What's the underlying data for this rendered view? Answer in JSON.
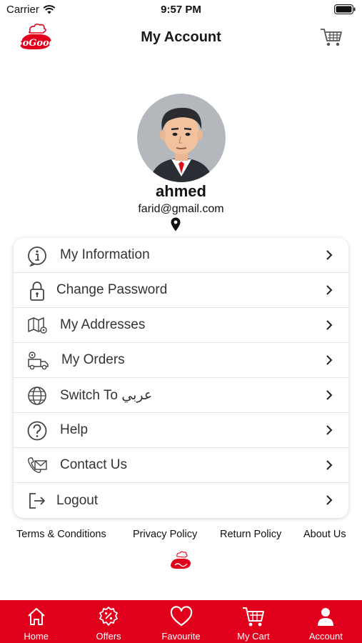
{
  "status_bar": {
    "carrier": "Carrier",
    "time": "9:57 PM"
  },
  "header": {
    "title": "My Account",
    "logo_text": "SoGood"
  },
  "profile": {
    "name": "ahmed",
    "email": "farid@gmail.com"
  },
  "menu": [
    {
      "label": "My Information",
      "icon": "info-icon"
    },
    {
      "label": "Change Password",
      "icon": "lock-icon"
    },
    {
      "label": "My Addresses",
      "icon": "map-icon"
    },
    {
      "label": "My Orders",
      "icon": "delivery-truck-icon"
    },
    {
      "label": "Switch To عربي",
      "icon": "globe-icon"
    },
    {
      "label": "Help",
      "icon": "help-icon"
    },
    {
      "label": "Contact Us",
      "icon": "contact-icon"
    },
    {
      "label": "Logout",
      "icon": "logout-icon"
    }
  ],
  "footer": {
    "terms": "Terms & Conditions",
    "privacy": "Privacy Policy",
    "return": "Return Policy",
    "about": "About Us"
  },
  "tabs": [
    {
      "label": "Home",
      "icon": "home-icon"
    },
    {
      "label": "Offers",
      "icon": "offers-icon"
    },
    {
      "label": "Favourite",
      "icon": "heart-icon"
    },
    {
      "label": "My Cart",
      "icon": "cart-icon"
    },
    {
      "label": "Account",
      "icon": "user-icon"
    }
  ],
  "colors": {
    "brand_red": "#e1001b",
    "text": "#333333"
  }
}
